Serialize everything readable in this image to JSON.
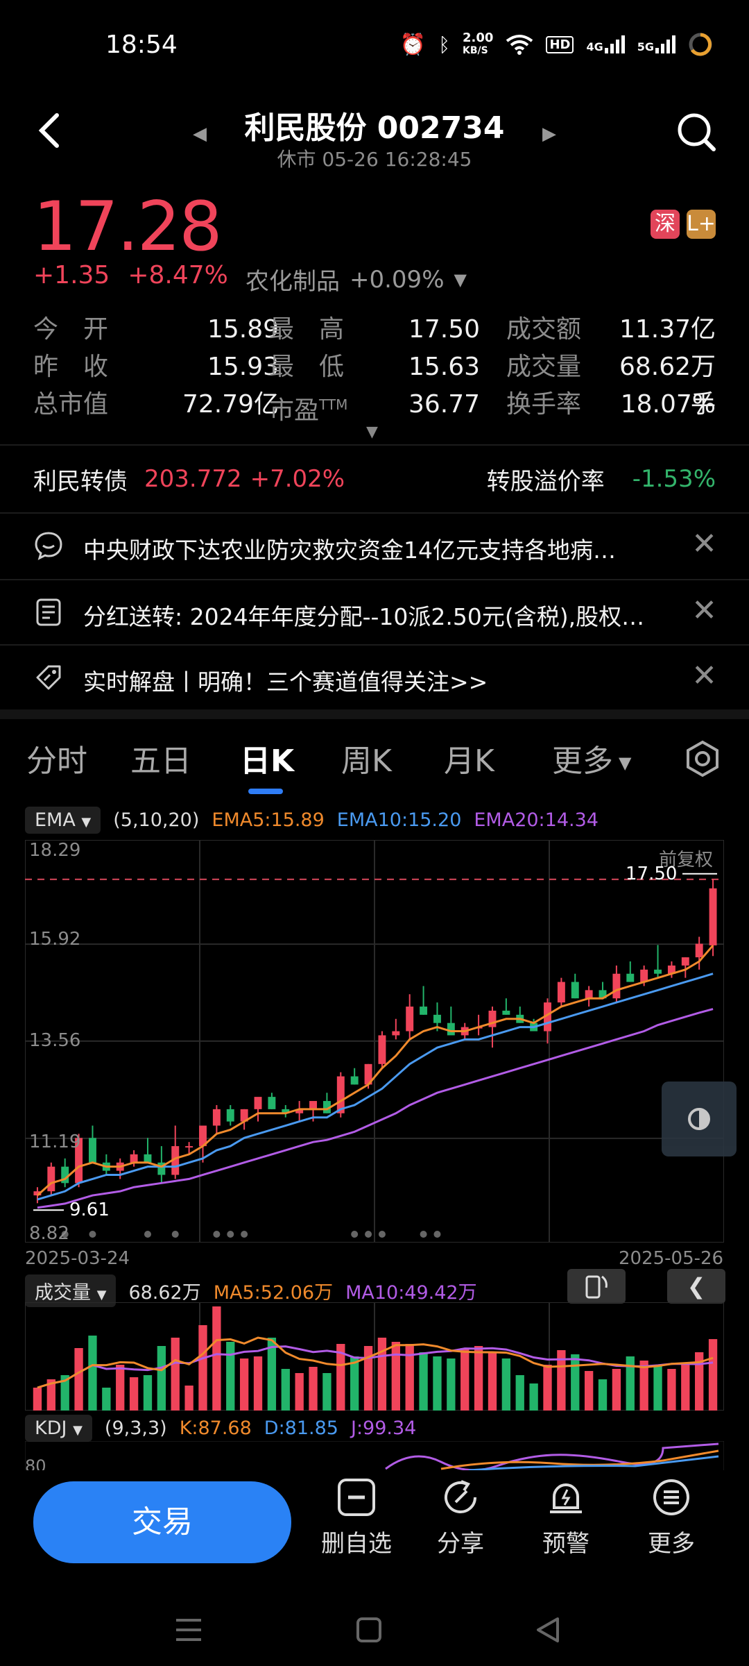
{
  "status": {
    "time": "18:54",
    "net_speed_top": "2.00",
    "net_speed_unit": "KB/S",
    "hd": "HD",
    "sig1": "4G",
    "sig2": "5G"
  },
  "header": {
    "title": "利民股份 002734",
    "subtitle": "休市  05-26 16:28:45"
  },
  "price": {
    "last": "17.28",
    "change": "+1.35",
    "pct": "+8.47%",
    "sector": "农化制品",
    "sector_pct": "+0.09%",
    "badge1": "深",
    "badge2": "L+"
  },
  "stats": {
    "open_l": "今　开",
    "open_v": "15.89",
    "high_l": "最　高",
    "high_v": "17.50",
    "amount_l": "成交额",
    "amount_v": "11.37亿",
    "prev_l": "昨　收",
    "prev_v": "15.93",
    "low_l": "最　低",
    "low_v": "15.63",
    "volume_l": "成交量",
    "volume_v": "68.62万手",
    "mcap_l": "总市值",
    "mcap_v": "72.79亿",
    "pe_l": "市盈",
    "pe_sup": "TTM",
    "pe_v": "36.77",
    "turn_l": "换手率",
    "turn_v": "18.07%"
  },
  "bond": {
    "name": "利民转债",
    "price": "203.772",
    "pct": "+7.02%",
    "prem_l": "转股溢价率",
    "prem_v": "-1.53%"
  },
  "news": [
    {
      "text": "中央财政下达农业防灾救灾资金14亿元支持各地病…",
      "icon": "chat-icon"
    },
    {
      "text": "分红送转: 2024年年度分配--10派2.50元(含税),股权…",
      "icon": "document-icon"
    },
    {
      "text": "实时解盘丨明确！三个赛道值得关注>>",
      "icon": "tag-icon"
    }
  ],
  "tabs": [
    "分时",
    "五日",
    "日K",
    "周K",
    "月K",
    "更多"
  ],
  "ema": {
    "name": "EMA",
    "params": "(5,10,20)",
    "e5": "EMA5:15.89",
    "e10": "EMA10:15.20",
    "e20": "EMA20:14.34",
    "colors": {
      "e5": "#f08a2c",
      "e10": "#4a9af0",
      "e20": "#b25ce6"
    }
  },
  "chart_labels": {
    "y_top": "18.29",
    "y2": "15.92",
    "y3": "13.56",
    "y4": "11.19",
    "y_bot": "8.82",
    "fq": "前复权",
    "high_mark": "17.50",
    "low_mark": "9.61",
    "date_start": "2025-03-24",
    "date_end": "2025-05-26"
  },
  "volume": {
    "name": "成交量",
    "value": "68.62万",
    "ma5": "MA5:52.06万",
    "ma10": "MA10:49.42万"
  },
  "kdj": {
    "name": "KDJ",
    "params": "(9,3,3)",
    "k": "K:87.68",
    "d": "D:81.85",
    "j": "J:99.34",
    "ylbl": "80"
  },
  "bottom": {
    "trade": "交易",
    "b1": "删自选",
    "b2": "分享",
    "b3": "预警",
    "b4": "更多"
  },
  "chart_data": {
    "type": "candlestick",
    "x": [
      "2025-03-24",
      "",
      "",
      "",
      "",
      "",
      "",
      "",
      "",
      "",
      "",
      "",
      "",
      "",
      "",
      "",
      "",
      "",
      "",
      "",
      "",
      "",
      "",
      "",
      "",
      "",
      "",
      "",
      "",
      "",
      "",
      "",
      "",
      "",
      "",
      "",
      "",
      "",
      "",
      "",
      "",
      "",
      "2025-05-26"
    ],
    "ohlc": [
      [
        9.8,
        10.0,
        9.61,
        9.9
      ],
      [
        9.9,
        10.6,
        9.8,
        10.5
      ],
      [
        10.5,
        10.7,
        10.0,
        10.1
      ],
      [
        10.1,
        11.3,
        10.0,
        11.2
      ],
      [
        11.2,
        11.5,
        10.9,
        10.6
      ],
      [
        10.6,
        10.8,
        10.3,
        10.4
      ],
      [
        10.4,
        10.7,
        10.2,
        10.6
      ],
      [
        10.6,
        10.9,
        10.5,
        10.8
      ],
      [
        10.8,
        11.2,
        10.6,
        10.6
      ],
      [
        10.6,
        11.0,
        10.1,
        10.3
      ],
      [
        10.3,
        11.5,
        10.2,
        11.0
      ],
      [
        11.0,
        11.1,
        10.8,
        11.0
      ],
      [
        11.0,
        11.3,
        10.6,
        11.5
      ],
      [
        11.5,
        12.0,
        11.3,
        11.9
      ],
      [
        11.9,
        12.0,
        11.5,
        11.6
      ],
      [
        11.6,
        11.9,
        11.4,
        11.9
      ],
      [
        11.9,
        12.1,
        11.6,
        12.2
      ],
      [
        12.2,
        12.3,
        11.9,
        11.9
      ],
      [
        11.9,
        12.0,
        11.7,
        11.8
      ],
      [
        11.8,
        12.1,
        11.6,
        11.9
      ],
      [
        11.9,
        12.0,
        11.6,
        12.1
      ],
      [
        12.1,
        12.3,
        11.8,
        11.8
      ],
      [
        11.8,
        12.8,
        11.7,
        12.7
      ],
      [
        12.7,
        12.9,
        12.5,
        12.5
      ],
      [
        12.5,
        13.0,
        12.4,
        13.0
      ],
      [
        13.0,
        13.8,
        12.9,
        13.7
      ],
      [
        13.7,
        14.1,
        13.6,
        13.8
      ],
      [
        13.8,
        14.7,
        13.6,
        14.4
      ],
      [
        14.4,
        14.9,
        14.2,
        14.2
      ],
      [
        14.2,
        14.5,
        13.8,
        14.0
      ],
      [
        14.0,
        14.4,
        13.8,
        13.7
      ],
      [
        13.7,
        14.0,
        13.6,
        13.9
      ],
      [
        13.9,
        14.2,
        13.7,
        13.9
      ],
      [
        13.9,
        14.4,
        13.4,
        14.3
      ],
      [
        14.3,
        14.6,
        14.2,
        14.2
      ],
      [
        14.2,
        14.4,
        14.0,
        14.0
      ],
      [
        14.0,
        14.1,
        13.8,
        13.8
      ],
      [
        13.8,
        14.6,
        13.5,
        14.5
      ],
      [
        14.5,
        15.1,
        14.4,
        15.0
      ],
      [
        15.0,
        15.2,
        14.6,
        14.6
      ],
      [
        14.6,
        14.9,
        14.4,
        14.8
      ],
      [
        14.8,
        15.0,
        14.6,
        14.6
      ],
      [
        14.6,
        15.4,
        14.5,
        15.2
      ],
      [
        15.2,
        15.5,
        15.0,
        15.0
      ],
      [
        15.0,
        15.4,
        14.9,
        15.3
      ],
      [
        15.3,
        15.9,
        15.1,
        15.2
      ],
      [
        15.2,
        15.5,
        15.1,
        15.4
      ],
      [
        15.4,
        15.6,
        15.1,
        15.6
      ],
      [
        15.6,
        16.1,
        15.3,
        15.93
      ],
      [
        15.89,
        17.5,
        15.63,
        17.28
      ]
    ],
    "ema5": [
      9.8,
      10.1,
      10.2,
      10.5,
      10.6,
      10.5,
      10.5,
      10.6,
      10.6,
      10.5,
      10.7,
      10.8,
      11.0,
      11.3,
      11.4,
      11.6,
      11.8,
      11.8,
      11.8,
      11.9,
      11.9,
      11.9,
      12.1,
      12.3,
      12.5,
      12.9,
      13.2,
      13.6,
      13.8,
      13.9,
      13.8,
      13.8,
      13.9,
      14.0,
      14.1,
      14.1,
      14.0,
      14.2,
      14.4,
      14.5,
      14.6,
      14.6,
      14.8,
      14.9,
      15.0,
      15.1,
      15.2,
      15.3,
      15.5,
      15.89
    ],
    "ema10": [
      9.7,
      9.8,
      9.9,
      10.1,
      10.2,
      10.3,
      10.3,
      10.4,
      10.5,
      10.5,
      10.5,
      10.6,
      10.7,
      10.9,
      11.0,
      11.2,
      11.3,
      11.4,
      11.5,
      11.6,
      11.7,
      11.7,
      11.9,
      12.0,
      12.2,
      12.4,
      12.7,
      13.0,
      13.2,
      13.4,
      13.5,
      13.6,
      13.6,
      13.7,
      13.8,
      13.9,
      13.9,
      14.0,
      14.1,
      14.2,
      14.3,
      14.4,
      14.5,
      14.6,
      14.7,
      14.8,
      14.9,
      15.0,
      15.1,
      15.2
    ],
    "ema20": [
      9.5,
      9.55,
      9.6,
      9.7,
      9.8,
      9.85,
      9.9,
      10.0,
      10.05,
      10.1,
      10.15,
      10.2,
      10.3,
      10.4,
      10.5,
      10.6,
      10.7,
      10.8,
      10.9,
      11.0,
      11.1,
      11.15,
      11.25,
      11.35,
      11.5,
      11.65,
      11.8,
      12.0,
      12.15,
      12.3,
      12.4,
      12.5,
      12.6,
      12.7,
      12.8,
      12.9,
      13.0,
      13.1,
      13.2,
      13.3,
      13.4,
      13.5,
      13.6,
      13.7,
      13.8,
      13.95,
      14.05,
      14.15,
      14.25,
      14.34
    ],
    "volume": [
      22,
      30,
      34,
      60,
      72,
      22,
      44,
      32,
      34,
      62,
      70,
      24,
      82,
      100,
      66,
      50,
      52,
      70,
      40,
      36,
      42,
      36,
      64,
      52,
      62,
      70,
      66,
      64,
      56,
      52,
      50,
      60,
      62,
      56,
      50,
      34,
      26,
      44,
      58,
      54,
      38,
      30,
      40,
      52,
      48,
      44,
      40,
      44,
      56,
      68.62
    ],
    "ylim": [
      8.82,
      18.29
    ]
  }
}
